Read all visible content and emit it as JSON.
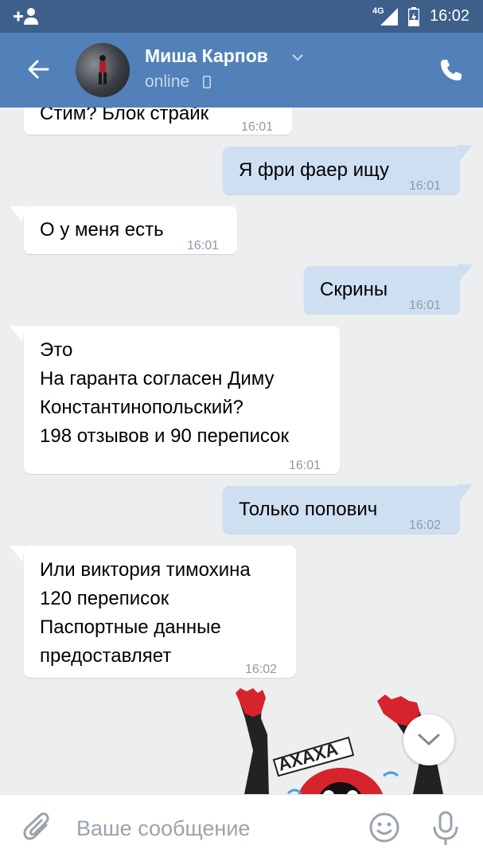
{
  "status_bar": {
    "network": "4G",
    "time": "16:02"
  },
  "header": {
    "contact_name": "Миша Карпов",
    "contact_status": "online"
  },
  "messages": [
    {
      "direction": "in",
      "text": "Стим? Блок страйк",
      "time": "16:01"
    },
    {
      "direction": "out",
      "text": "Я фри фаер ищу",
      "time": "16:01"
    },
    {
      "direction": "in",
      "text": "О у меня есть",
      "time": "16:01"
    },
    {
      "direction": "out",
      "text": "Скрины",
      "time": "16:01"
    },
    {
      "direction": "in",
      "text": "Это\nНа гаранта согласен Диму\nКонстантинопольский?\n198 отзывов и 90 переписок",
      "time": "16:01"
    },
    {
      "direction": "out",
      "text": "Только попович",
      "time": "16:02"
    },
    {
      "direction": "in",
      "text": "Или виктория тимохина\n120 переписок\nПаспортные данные\nпредоставляет",
      "time": "16:02"
    }
  ],
  "sticker": {
    "text": "АХАХА"
  },
  "composer": {
    "placeholder": "Ваше сообщение"
  },
  "colors": {
    "status_bar": "#3e5f8a",
    "header": "#5181b8",
    "background": "#edeef0",
    "outgoing_bubble": "#cfdff2",
    "incoming_bubble": "#ffffff",
    "icon_gray": "#9aa3ad"
  },
  "icons": {
    "status_left": "add-user-icon",
    "back": "arrow-left-icon",
    "call": "phone-icon",
    "attach": "paperclip-icon",
    "emoji": "smile-icon",
    "mic": "microphone-icon",
    "scroll": "chevron-down-icon"
  }
}
